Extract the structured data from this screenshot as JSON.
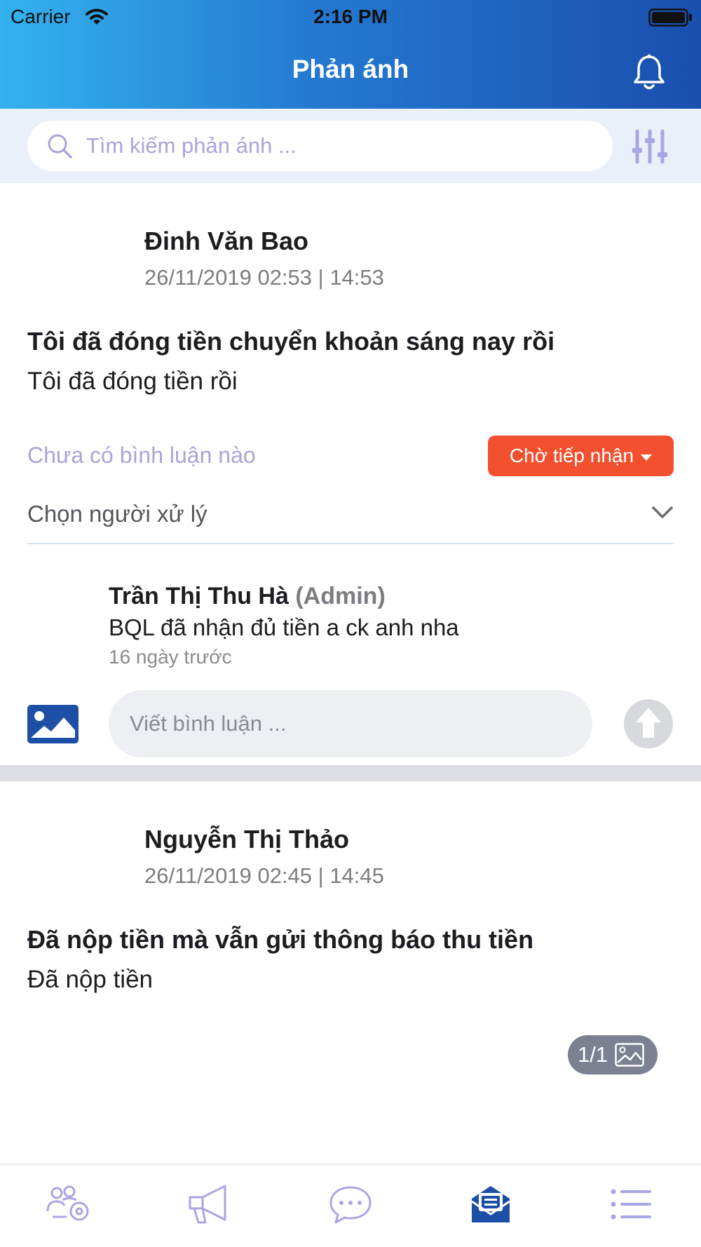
{
  "status_bar": {
    "carrier": "Carrier",
    "time": "2:16 PM"
  },
  "header": {
    "title": "Phản ánh"
  },
  "search": {
    "placeholder": "Tìm kiếm phản ánh ..."
  },
  "feedbacks": [
    {
      "author": "Đinh Văn Bao",
      "datetime": "26/11/2019 02:53 | 14:53",
      "title": "Tôi đã đóng tiền chuyển khoản sáng nay rồi",
      "body": "Tôi đã đóng tiền rồi",
      "no_comment": "Chưa có bình luận nào",
      "status": "Chờ tiếp nhận",
      "assignee_placeholder": "Chọn người xử lý",
      "comment": {
        "author": "Trần Thị Thu Hà",
        "role": "(Admin)",
        "text": "BQL đã nhận đủ tiền a ck anh nha",
        "time": "16 ngày trước"
      },
      "comment_placeholder": "Viết bình luận ..."
    },
    {
      "author": "Nguyễn Thị Thảo",
      "datetime": "26/11/2019 02:45 | 14:45",
      "title": "Đã nộp tiền mà vẫn gửi thông báo thu tiền",
      "body": "Đã nộp tiền",
      "image_count": "1/1"
    }
  ],
  "tabbar": {
    "active_index": 3,
    "items": [
      {
        "icon": "community-settings-icon"
      },
      {
        "icon": "megaphone-icon"
      },
      {
        "icon": "chat-bubble-icon"
      },
      {
        "icon": "feedback-mail-icon"
      },
      {
        "icon": "list-icon"
      }
    ]
  },
  "colors": {
    "header_gradient_start": "#33b2ee",
    "header_gradient_end": "#1a4fae",
    "status_badge": "#f3502f",
    "tab_inactive": "#a9a6e4",
    "tab_active": "#1d4fa6",
    "placeholder": "#a7a6d8"
  }
}
